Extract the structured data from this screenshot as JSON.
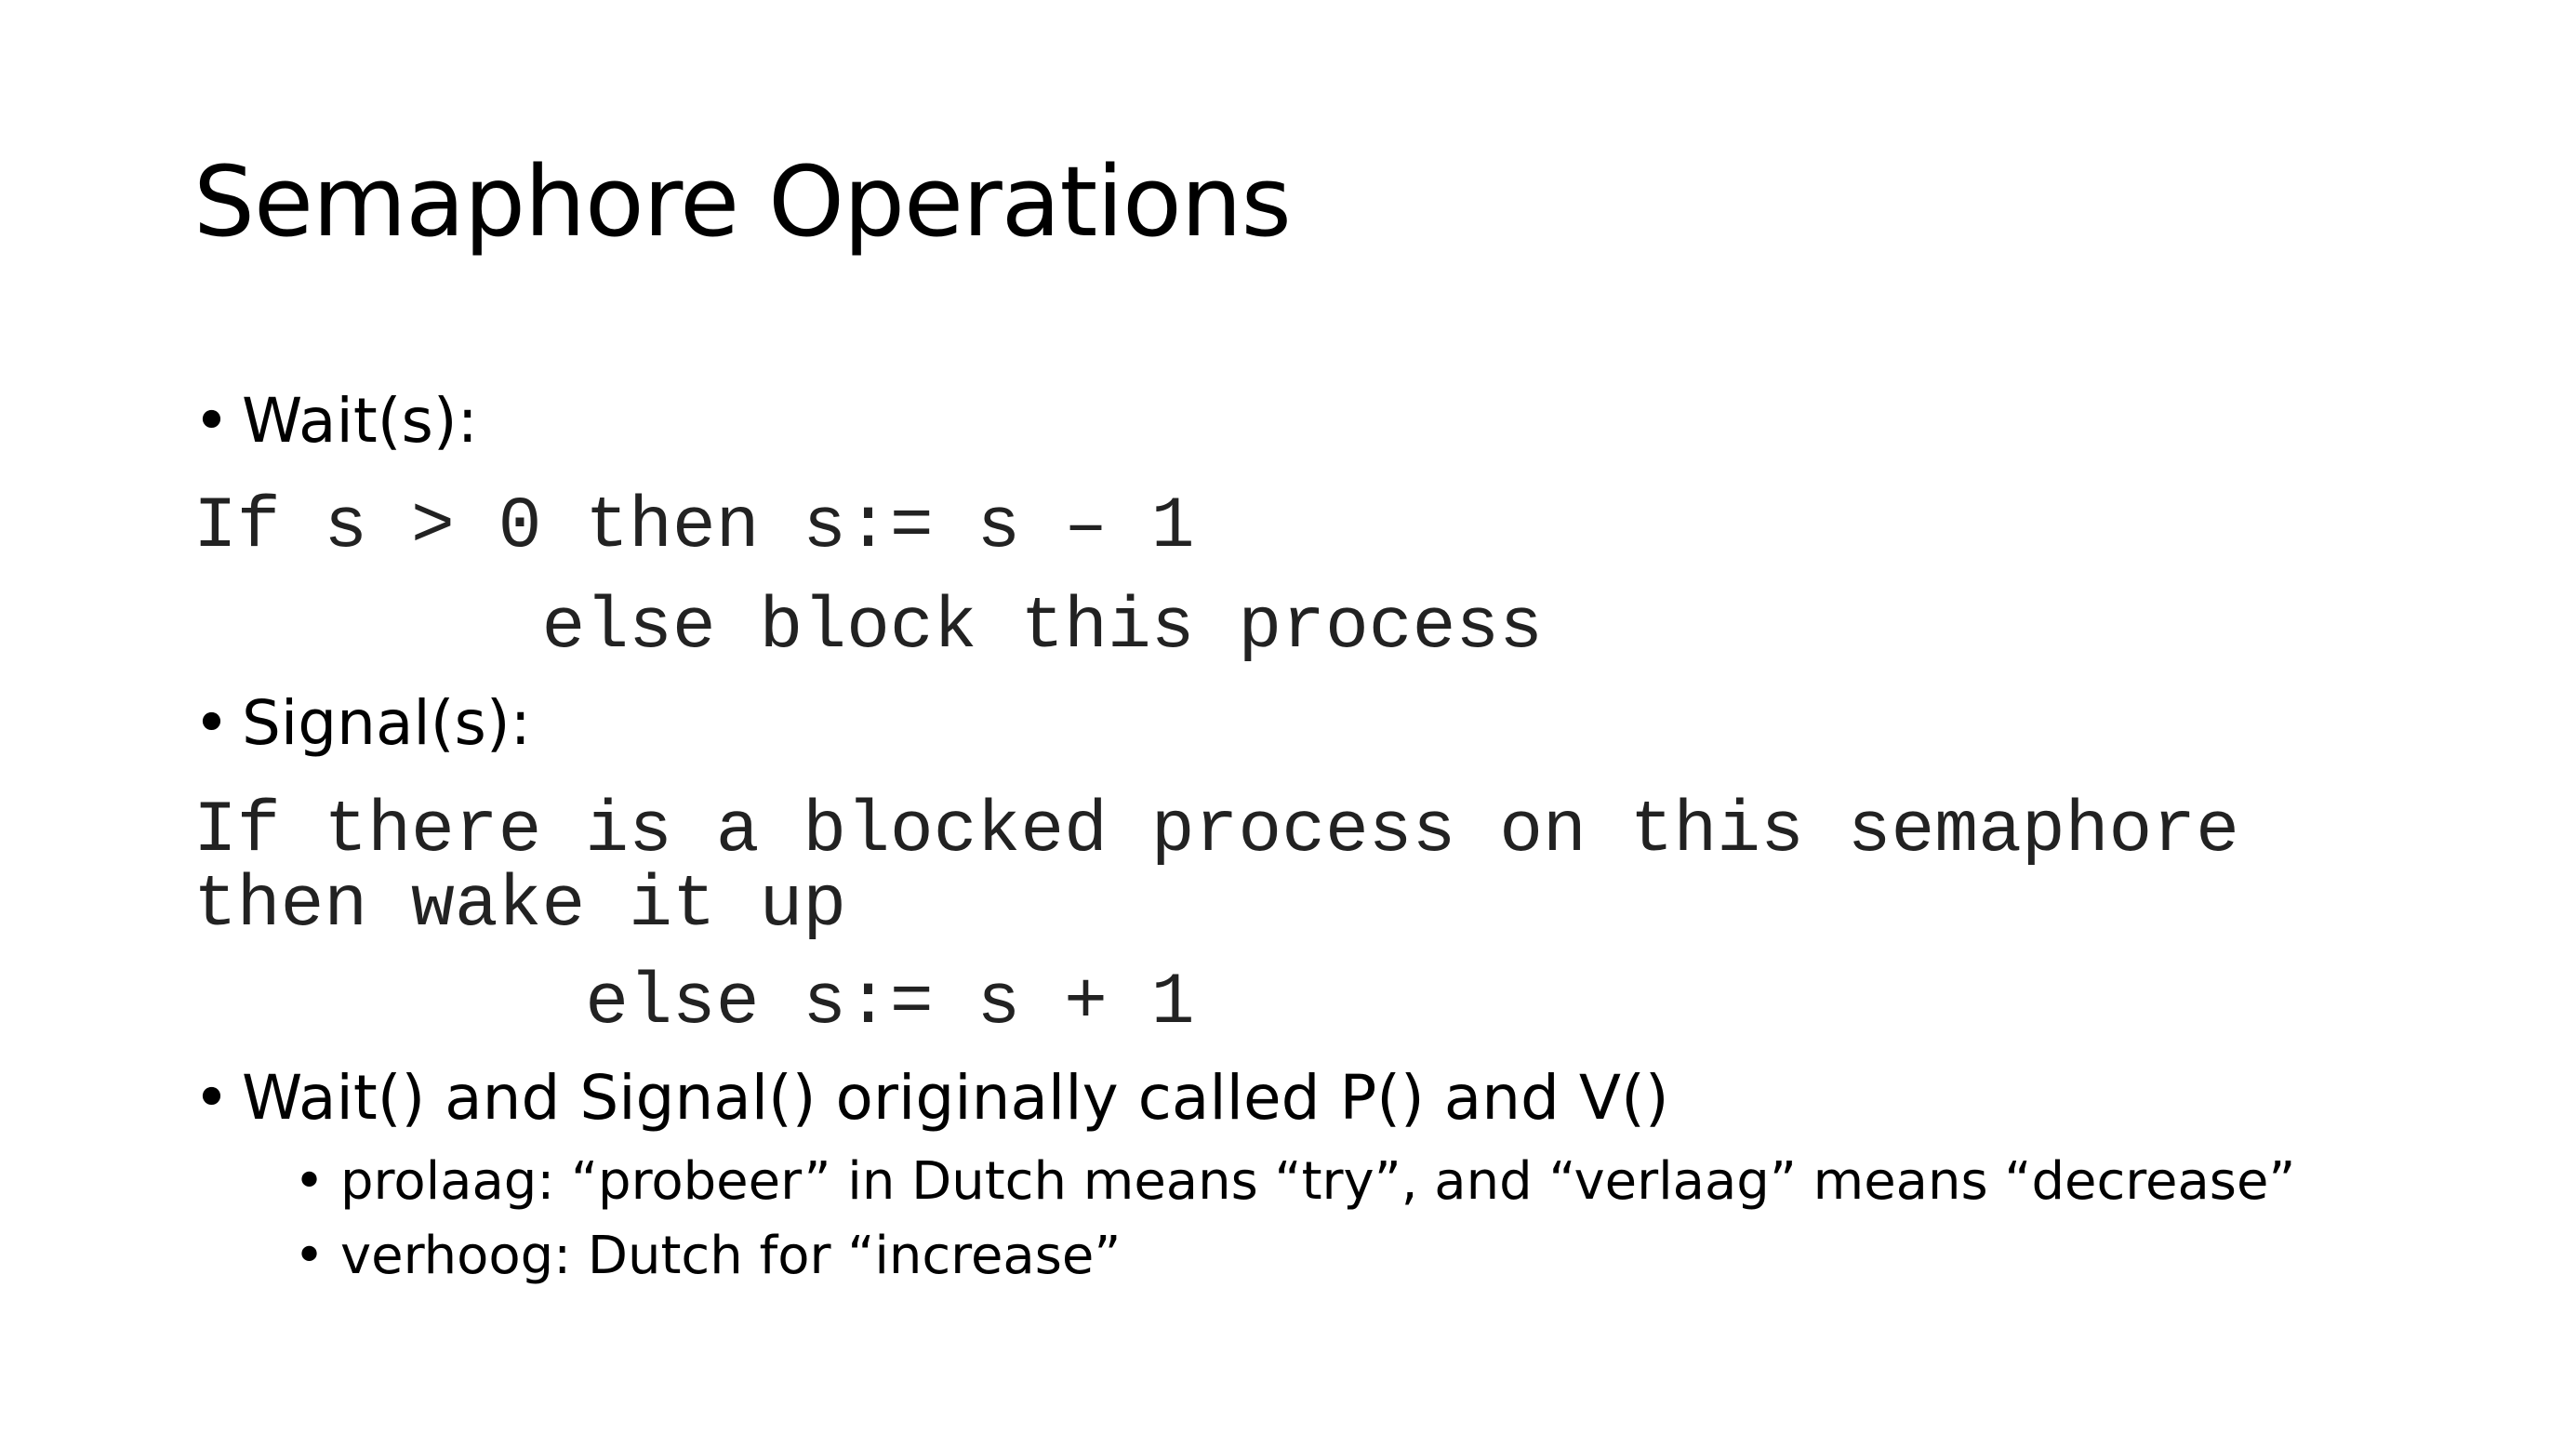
{
  "slide": {
    "title": "Semaphore Operations",
    "bullets": [
      {
        "text": "Wait(s):"
      },
      {
        "text": "Signal(s):"
      },
      {
        "text": "Wait() and Signal() originally called P() and V()"
      }
    ],
    "code": {
      "wait_line1": "If s > 0 then s:= s – 1",
      "wait_line2": "        else block this process",
      "signal_line1": "If there is a blocked process on this semaphore",
      "signal_line2": "then wake it up",
      "signal_line3": "         else s:= s + 1"
    },
    "subbullets": [
      {
        "text": "prolaag: “probeer” in Dutch means “try”, and “verlaag” means “decrease”"
      },
      {
        "text": "verhoog: Dutch for “increase”"
      }
    ],
    "bullet_glyph": "•"
  }
}
